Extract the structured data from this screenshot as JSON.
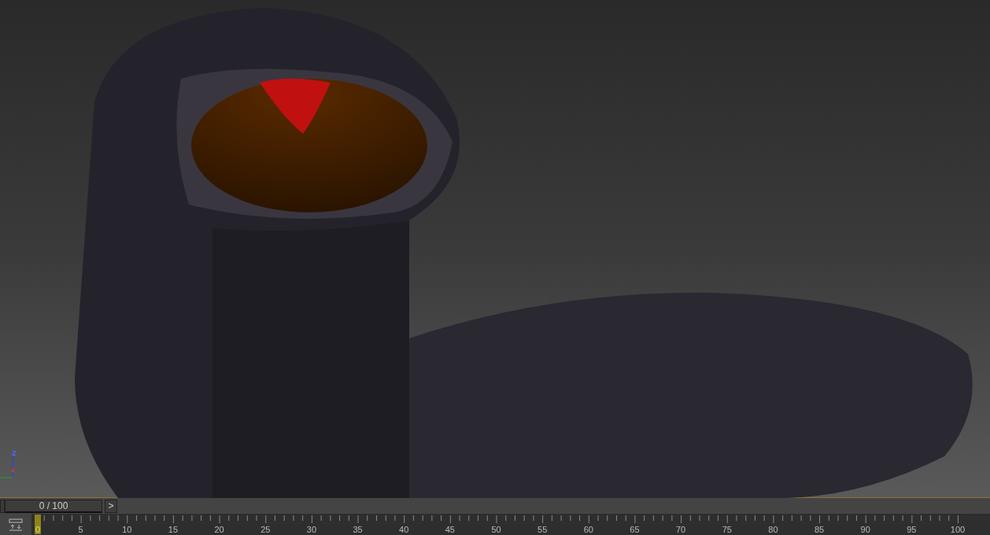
{
  "viewport": {
    "axis_labels": [
      "z",
      "x"
    ]
  },
  "time_slider": {
    "label": "0 / 100",
    "next": ">",
    "level": 0
  },
  "timeline": {
    "current_frame": "0",
    "labels": [
      "5",
      "10",
      "15",
      "20",
      "25",
      "30",
      "35",
      "40",
      "45",
      "50",
      "55",
      "60",
      "65",
      "70",
      "75",
      "80",
      "85",
      "90",
      "95",
      "100"
    ]
  }
}
